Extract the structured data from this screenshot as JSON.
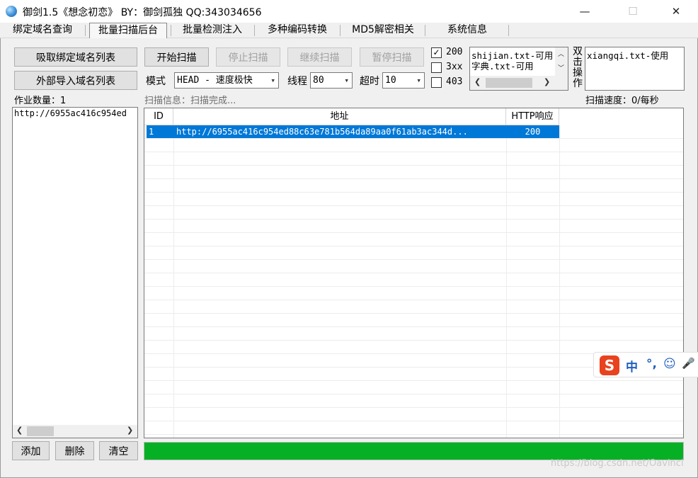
{
  "window": {
    "title": "御剑1.5《想念初恋》 BY：御剑孤独 QQ:343034656",
    "minimize": "—",
    "maximize": "☐",
    "close": "✕"
  },
  "menu": [
    "绑定域名查询",
    "批量扫描后台",
    "批量检测注入",
    "多种编码转换",
    "MD5解密相关",
    "系统信息"
  ],
  "left": {
    "absorb_button": "吸取绑定域名列表",
    "import_button": "外部导入域名列表",
    "job_count_label": "作业数量：1",
    "domain_list": [
      "http://6955ac416c954ed"
    ],
    "add_button": "添加",
    "delete_button": "删除",
    "clear_button": "清空"
  },
  "toolbar": {
    "start": "开始扫描",
    "stop": "停止扫描",
    "resume": "继续扫描",
    "pause": "暂停扫描",
    "mode_label": "模式",
    "mode_value": "HEAD - 速度极快",
    "threads_label": "线程",
    "threads_value": "80",
    "timeout_label": "超时",
    "timeout_value": "10"
  },
  "status_filters": [
    {
      "label": "200",
      "checked": true
    },
    {
      "label": "3xx",
      "checked": false
    },
    {
      "label": "403",
      "checked": false
    }
  ],
  "dictionary_list": [
    "shijian.txt-可用",
    "字典.txt-可用"
  ],
  "double_click_label": "双击操作",
  "selected_dict_list": [
    "xiangqi.txt-使用"
  ],
  "scan_info": "扫描信息：扫描完成...",
  "scan_speed": "扫描速度：0/每秒",
  "results": {
    "columns": [
      "ID",
      "地址",
      "HTTP响应"
    ],
    "rows": [
      {
        "id": "1",
        "url": "http://6955ac416c954ed88c63e781b564da89aa0f61ab3ac344d...",
        "code": "200"
      }
    ]
  },
  "progress": 1.0,
  "ime": {
    "logo": "S",
    "lang": "中",
    "punct": "°,",
    "emoji": "☺",
    "mic": "🎤"
  },
  "watermark": "https://blog.csdn.net/Oavinci",
  "colors": {
    "selection": "#0078d7",
    "progress": "#06b025",
    "ime_logo": "#e8421e"
  }
}
